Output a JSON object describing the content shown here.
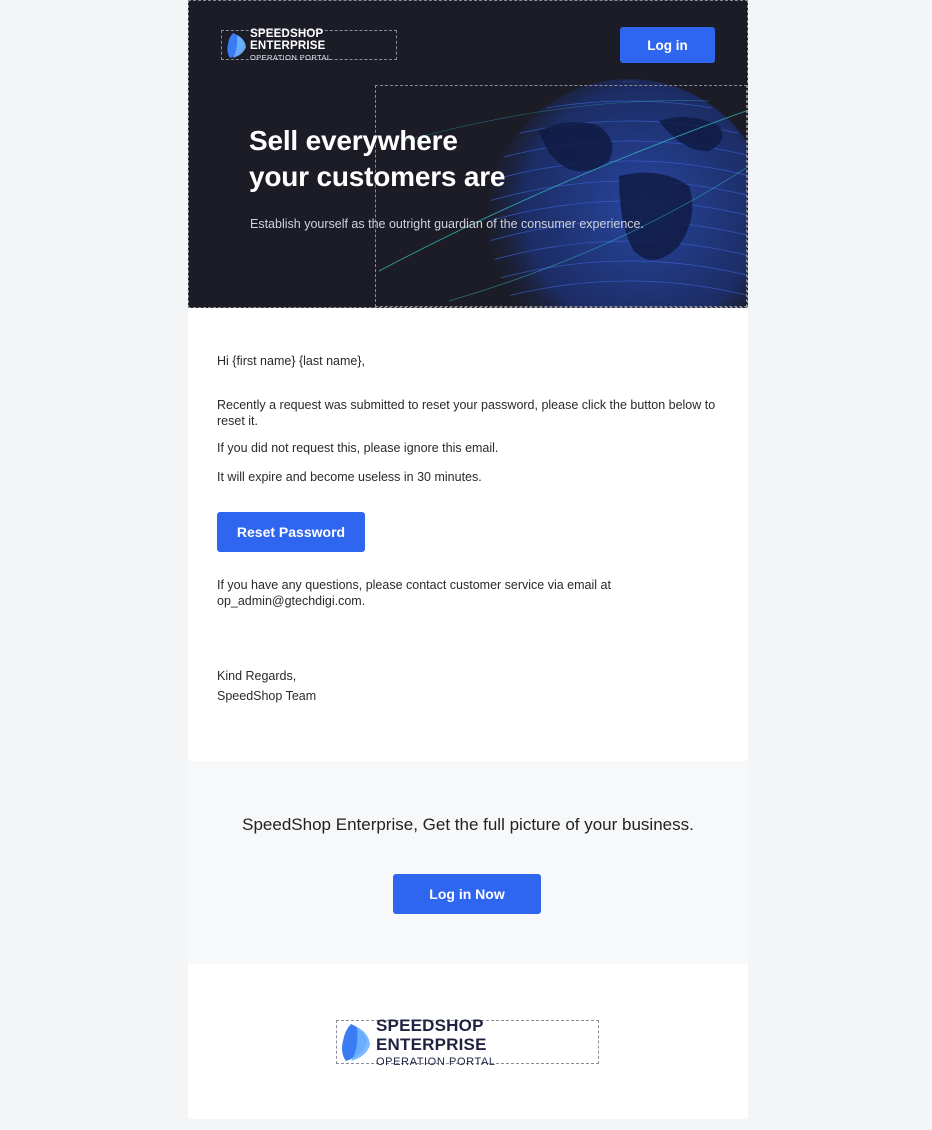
{
  "header": {
    "brand": "SPEEDSHOP ENTERPRISE",
    "brand_sub": "OPERATION PORTAL",
    "login_label": "Log in",
    "title_line1": "Sell everywhere",
    "title_line2": "your customers are",
    "subtitle": "Establish yourself as the outright guardian of the consumer experience."
  },
  "body": {
    "greeting": "Hi  {first name} {last name},",
    "paragraph1": "Recently a request was submitted to reset your password, please click the button below to reset it.",
    "paragraph2": "If you did not request this, please ignore this email.",
    "paragraph3": "It will expire and become useless in 30 minutes.",
    "reset_label": "Reset Password",
    "paragraph4": "If you have any questions, please contact customer service via email at op_admin@gtechdigi.com.",
    "regards_line1": "Kind Regards,",
    "regards_line2": "SpeedShop Team"
  },
  "cta": {
    "text": "SpeedShop Enterprise, Get the full picture of your business.",
    "login_now_label": "Log in Now"
  },
  "footer": {
    "brand": "SPEEDSHOP ENTERPRISE",
    "brand_sub": "OPERATION PORTAL"
  },
  "colors": {
    "accent": "#2e66f0",
    "hero_bg": "#1b1c26",
    "page_bg": "#f4f5f7"
  }
}
